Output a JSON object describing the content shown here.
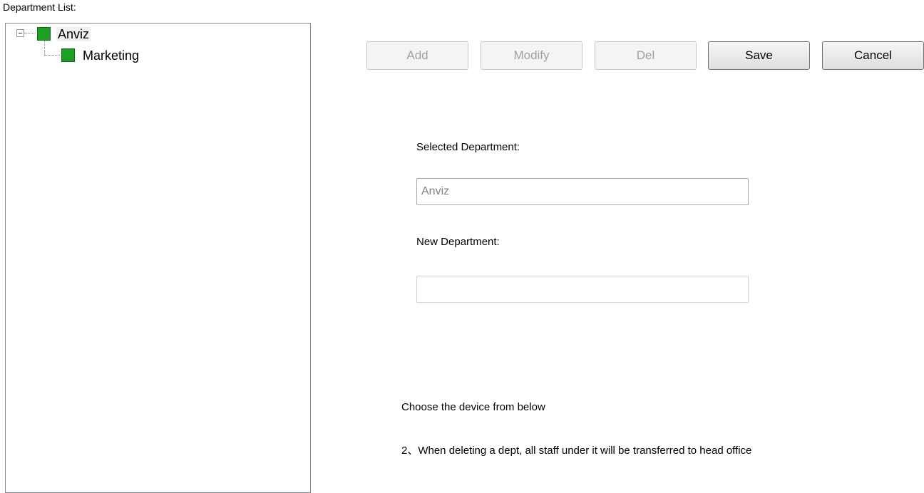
{
  "tree": {
    "label": "Department List:",
    "nodes": [
      {
        "label": "Anviz",
        "color": "#1e9e24",
        "expanded": true
      },
      {
        "label": "Marketing",
        "color": "#1e9e24"
      }
    ]
  },
  "toolbar": {
    "add": "Add",
    "modify": "Modify",
    "del": "Del",
    "save": "Save",
    "cancel": "Cancel"
  },
  "form": {
    "selected_label": "Selected Department:",
    "selected_value": "Anviz",
    "new_label": "New Department:",
    "new_value": ""
  },
  "notes": {
    "line1": "Choose the device from below",
    "line2": "2、When deleting a dept, all staff under it will be transferred to head office"
  }
}
